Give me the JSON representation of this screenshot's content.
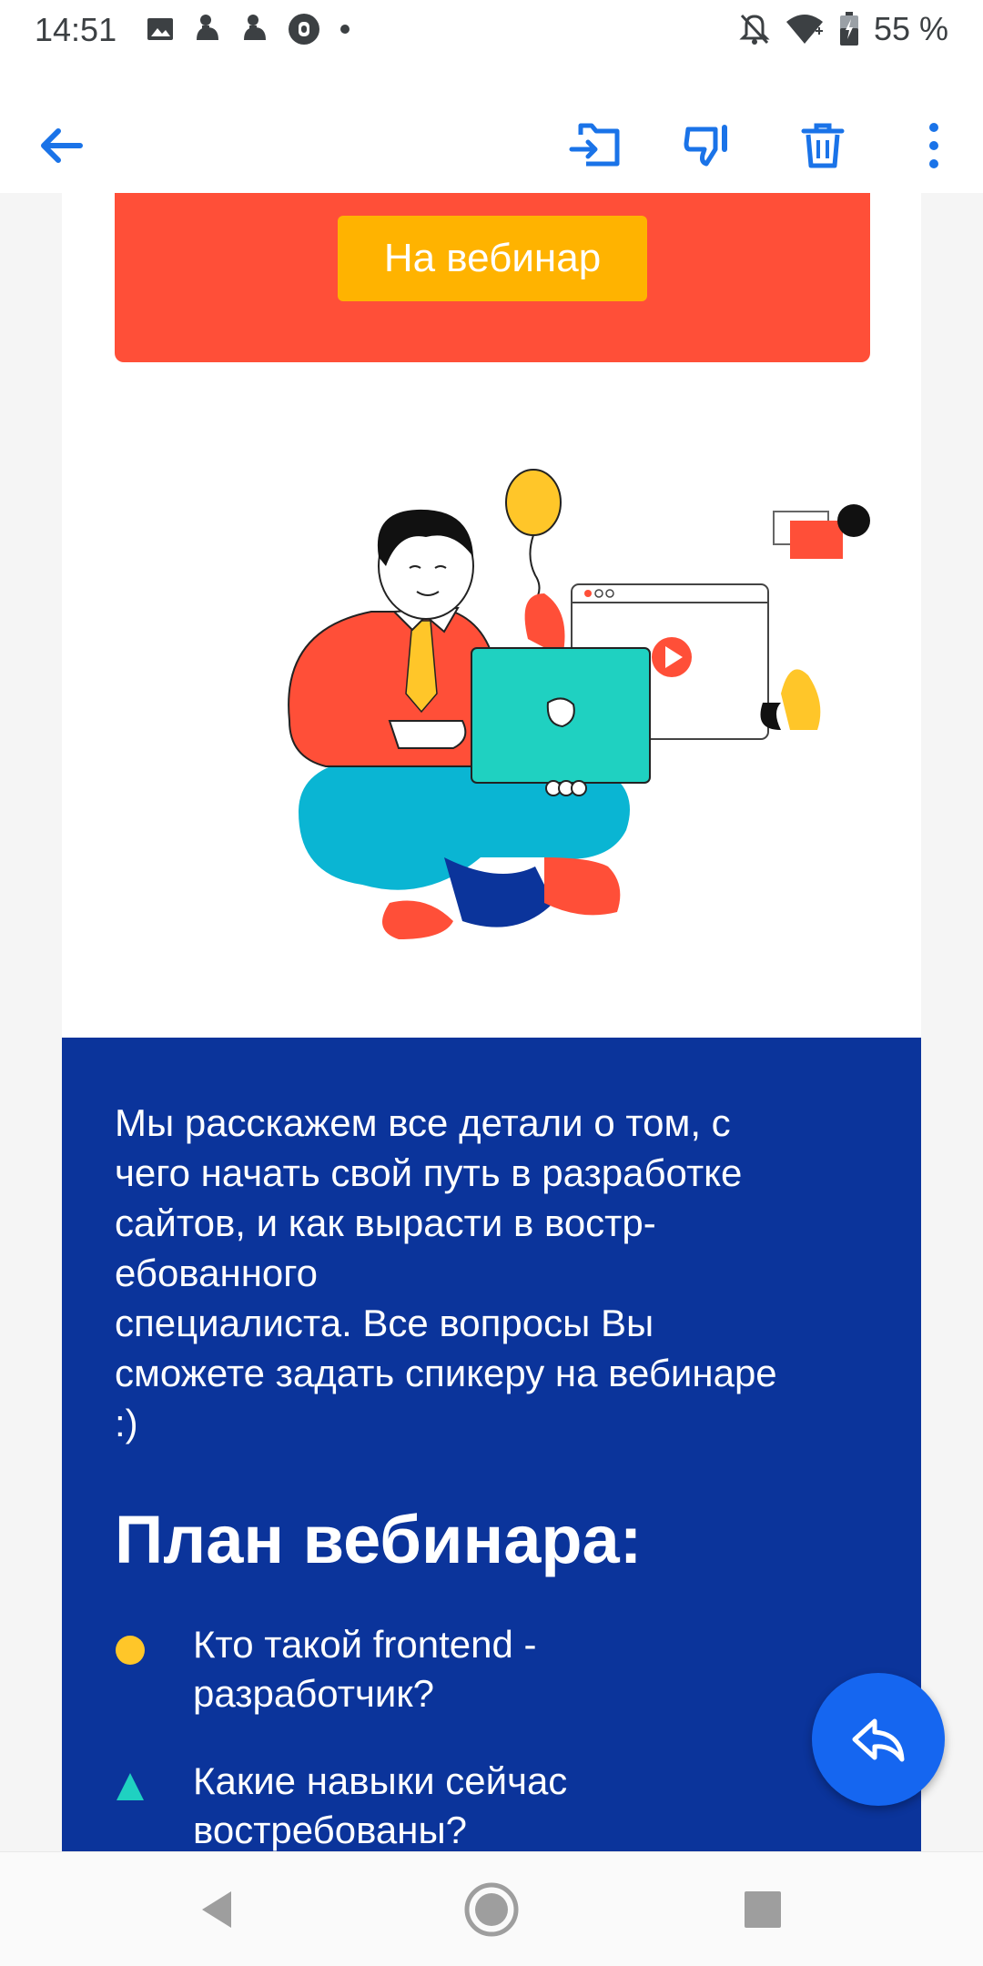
{
  "status_bar": {
    "time": "14:51",
    "battery_percent": "55 %",
    "notification_icons": [
      "gallery-icon",
      "android-debug-icon",
      "android-debug-icon",
      "lock-circle-icon",
      "dot-icon"
    ],
    "status_icons": [
      "notifications-off-icon",
      "wifi-icon",
      "battery-icon"
    ]
  },
  "action_bar": {
    "back_icon": "arrow-left-icon",
    "actions": [
      "move-to-folder-icon",
      "spam-thumb-down-icon",
      "trash-icon",
      "more-vertical-icon"
    ],
    "accent_color": "#1a73e8"
  },
  "email": {
    "banner": {
      "background": "#ff4f38",
      "button_label": "На вебинар",
      "button_color": "#ffb300"
    },
    "illustration": {
      "description_icons": [
        "person-with-laptop",
        "balloon",
        "video-window",
        "play-icon"
      ]
    },
    "body": {
      "background": "#0b349b",
      "intro": "Мы расскажем все детали о том, с\nчего начать свой путь в разработке\nсайтов, и как вырасти в востр-\nебованного\nспециалиста. Все вопросы Вы\nсможете задать спикеру на вебинаре\n:)",
      "plan_title": "План вебинара:",
      "plan_items": [
        {
          "text": "Кто такой frontend -\nразработчик?",
          "marker": "circle",
          "marker_color": "#ffc629"
        },
        {
          "text": "Какие навыки сейчас\nвостребованы?",
          "marker": "triangle",
          "marker_color": "#1fd1c1"
        }
      ]
    }
  },
  "fab": {
    "icon": "reply-icon",
    "color": "#1566f0"
  },
  "nav_bar": {
    "buttons": [
      "back-triangle-icon",
      "home-circle-icon",
      "recents-square-icon"
    ]
  }
}
